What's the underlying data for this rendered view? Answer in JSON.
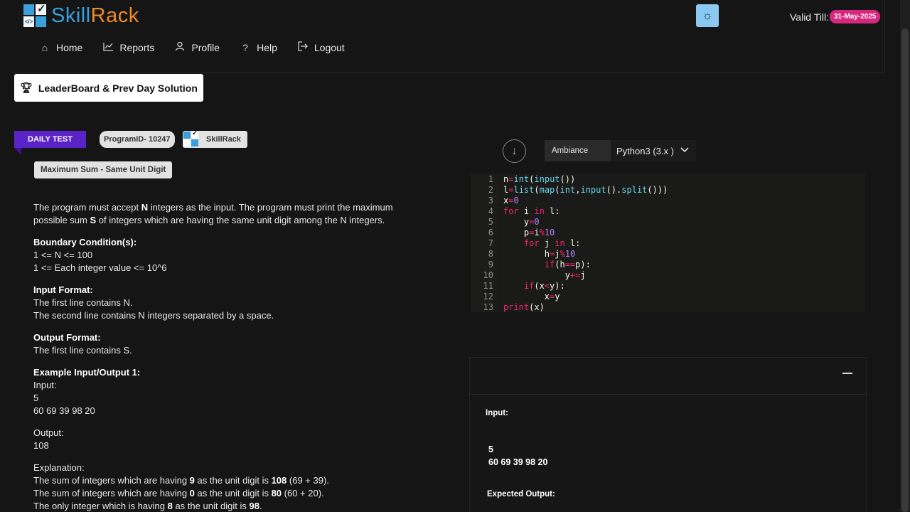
{
  "brand": {
    "name_part1": "Skill",
    "name_part2": "Rack"
  },
  "header": {
    "valid_till_label": "Valid Till:",
    "valid_till_date": "31-May-2025"
  },
  "nav": [
    {
      "label": "Home",
      "icon": "home-icon"
    },
    {
      "label": "Reports",
      "icon": "chart-icon"
    },
    {
      "label": "Profile",
      "icon": "user-icon"
    },
    {
      "label": "Help",
      "icon": "question-icon"
    },
    {
      "label": "Logout",
      "icon": "logout-icon"
    }
  ],
  "leaderboard_button": "LeaderBoard & Prev Day Solution",
  "problem": {
    "tag": "DAILY TEST",
    "program_id": "ProgramID- 10247",
    "source": "SkillRack",
    "title": "Maximum Sum - Same Unit Digit",
    "desc_1a": "The program must accept ",
    "desc_1b": "N",
    "desc_1c": " integers as the input. The program must print the maximum",
    "desc_2a": "possible sum ",
    "desc_2b": "S",
    "desc_2c": " of integers which are having the same unit digit among the N integers.",
    "boundary_heading": "Boundary Condition(s):",
    "boundary_1": "1 <= N <= 100",
    "boundary_2": "1 <= Each integer value <= 10^6",
    "input_heading": "Input Format:",
    "input_1": "The first line contains N.",
    "input_2": "The second line contains N integers separated by a space.",
    "output_heading": "Output Format:",
    "output_1": "The first line contains S.",
    "example_heading": "Example Input/Output 1:",
    "ex_input_label": "Input:",
    "ex_input_1": "5",
    "ex_input_2": "60 69 39 98 20",
    "ex_output_label": "Output:",
    "ex_output_1": "108",
    "explanation_label": "Explanation:",
    "exp1": {
      "a": "The sum of integers which are having ",
      "b": "9",
      "c": " as the unit digit is ",
      "d": "108",
      "e": " (69 + 39)."
    },
    "exp2": {
      "a": "The sum of integers which are having ",
      "b": "0",
      "c": " as the unit digit is ",
      "d": "80",
      "e": " (60 + 20)."
    },
    "exp3": {
      "a": "The only integer which is having ",
      "b": "8",
      "c": " as the unit digit is ",
      "d": "98",
      "e": "."
    }
  },
  "editor": {
    "theme": "Ambiance",
    "language": "Python3 (3.x )",
    "line_numbers": [
      "1",
      "2",
      "3",
      "4",
      "5",
      "6",
      "7",
      "8",
      "9",
      "10",
      "11",
      "12",
      "13"
    ]
  },
  "output_panel": {
    "input_label": "Input:",
    "input_line_1": "5",
    "input_line_2": "60 69 39 98 20",
    "expected_label": "Expected Output:"
  },
  "colors": {
    "accent_blue": "#3aa0dd",
    "accent_orange": "#f08a24",
    "daily_purple": "#5a23c8",
    "date_pink": "#d6287e"
  }
}
